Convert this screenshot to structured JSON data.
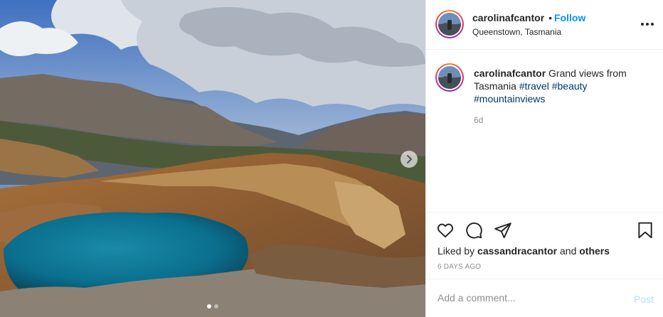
{
  "post": {
    "username": "carolinafcantor",
    "separator": "•",
    "follow_label": "Follow",
    "location": "Queenstown, Tasmania",
    "more_icon": "more-horizontal-icon",
    "carousel": {
      "slide_count": 2,
      "active_index": 0,
      "next_icon": "chevron-right-icon"
    }
  },
  "caption": {
    "username": "carolinafcantor",
    "text": "Grand views from Tasmania",
    "hashtags": [
      "#travel",
      "#beauty",
      "#mountainviews"
    ],
    "time": "6d"
  },
  "actions": {
    "icons": [
      "heart-icon",
      "comment-icon",
      "share-icon",
      "bookmark-icon"
    ],
    "liked_prefix": "Liked by",
    "liked_user": "cassandracantor",
    "liked_and": "and",
    "liked_others": "others",
    "timestamp": "6 DAYS AGO"
  },
  "comment": {
    "placeholder": "Add a comment...",
    "post_label": "Post"
  },
  "colors": {
    "accent": "#0095f6",
    "hashtag": "#00376b",
    "post_disabled": "#b2dffc",
    "muted": "#8e8e8e"
  }
}
